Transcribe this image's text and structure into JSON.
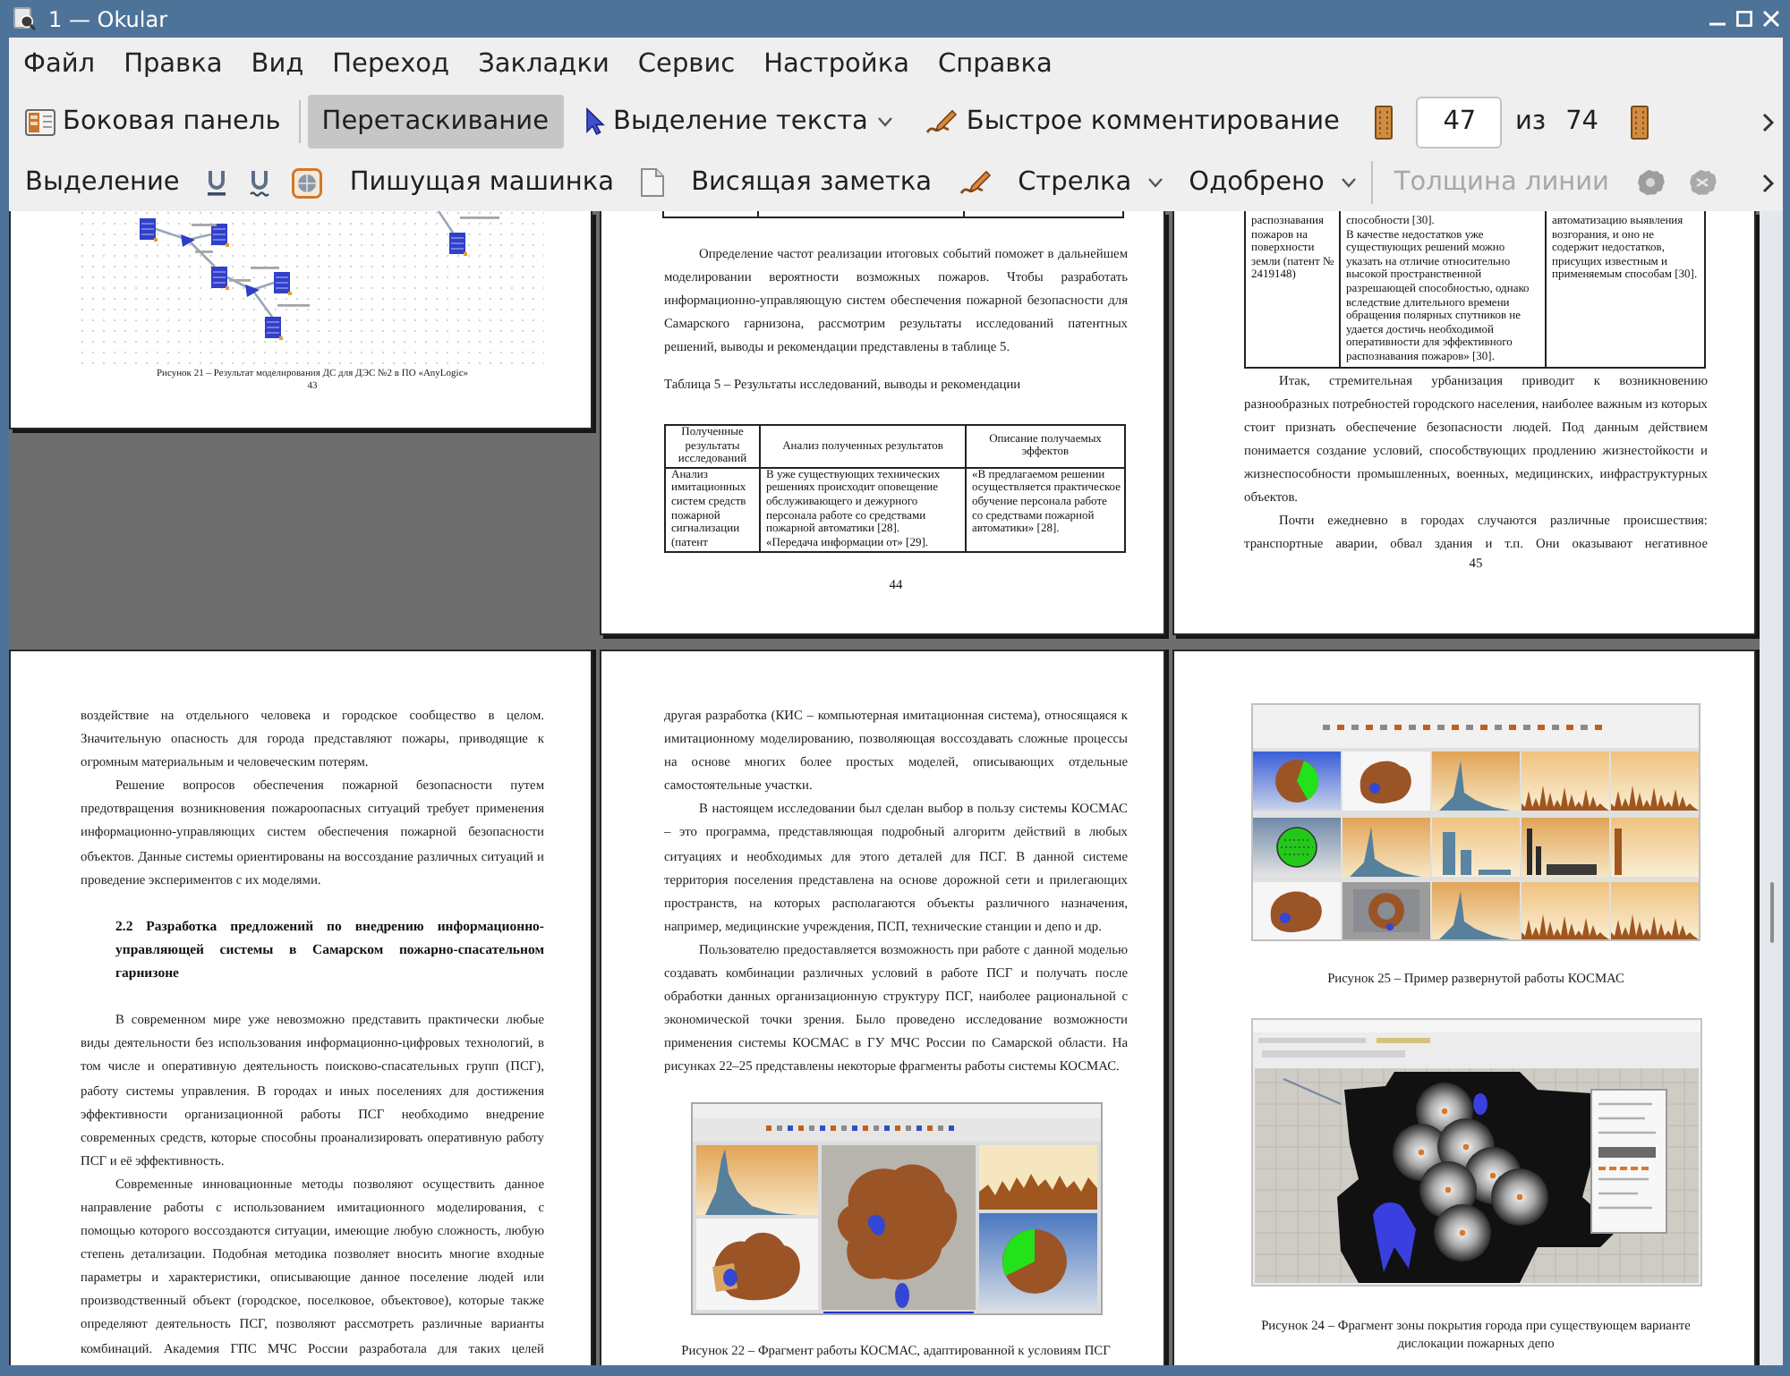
{
  "window": {
    "title": "1 — Okular"
  },
  "menu_bar": [
    "Файл",
    "Правка",
    "Вид",
    "Переход",
    "Закладки",
    "Сервис",
    "Настройка",
    "Справка"
  ],
  "main_toolbar": {
    "sidebar": {
      "label": "Боковая панель"
    },
    "mouse_modes": [
      {
        "label": "Перетаскивание",
        "selected": true,
        "has_menu": false
      },
      {
        "label": "Выделение текста",
        "selected": false,
        "has_menu": true
      }
    ],
    "quick_annotations": {
      "label": "Быстрое комментирование"
    },
    "page_selector": {
      "value": "47",
      "of": "из",
      "total": "74"
    }
  },
  "annotation_toolbar": [
    {
      "kind": "text",
      "label": "Выделение",
      "disabled": false
    },
    {
      "kind": "icon",
      "disabled": false
    },
    {
      "kind": "icon",
      "disabled": false
    },
    {
      "kind": "icon",
      "disabled": false
    },
    {
      "kind": "text",
      "label": "Пишущая машинка",
      "disabled": false
    },
    {
      "kind": "icon",
      "disabled": false
    },
    {
      "kind": "text",
      "label": "Висящая заметка",
      "disabled": false
    },
    {
      "kind": "icon",
      "disabled": false
    },
    {
      "kind": "menu",
      "label": "Стрелка",
      "disabled": false
    },
    {
      "kind": "menu",
      "label": "Одобрено",
      "disabled": false
    },
    {
      "kind": "separator"
    },
    {
      "kind": "text",
      "label": "Толщина линии",
      "disabled": true
    },
    {
      "kind": "icon",
      "disabled": true
    },
    {
      "kind": "icon",
      "disabled": true
    }
  ],
  "pages": [
    {
      "blocks": [
        {
          "kind": "diagram"
        },
        {
          "kind": "caption",
          "text": "Рисунок 21 – Результат моделирования ДС для ДЭС №2 в ПО «AnyLogic»"
        },
        {
          "kind": "page_number",
          "text": "43"
        }
      ]
    },
    {
      "blocks": [
        {
          "kind": "table_end"
        },
        {
          "kind": "paragraph",
          "text": "Определение частот реализации итоговых событий поможет в дальнейшем моделировании вероятности возможных пожаров. Чтобы разработать информационно-управляющую систем обеспечения пожарной безопасности для Самарского гарнизона, рассмотрим результаты исследований патентных решений, выводы и рекомендации представлены в таблице 5."
        },
        {
          "kind": "table_title",
          "text": "Таблица 5 – Результаты исследований, выводы и рекомендации"
        },
        {
          "kind": "table",
          "columns": [
            "Полученные результаты исследований",
            "Анализ полученных результатов",
            "Описание получаемых эффектов"
          ],
          "rows": [
            [
              "Анализ имитационных систем средств пожарной сигнализации (патент",
              "В уже существующих технических решениях происходит оповещение обслуживающего и дежурного персонала работе со средствами пожарной автоматики [28].\n«Передача информации от» [29].",
              "«В предлагаемом решении осуществляется практическое обучение персонала работе со средствами пожарной автоматики» [28]."
            ]
          ]
        },
        {
          "kind": "page_number",
          "text": "44"
        }
      ]
    },
    {
      "blocks": [
        {
          "kind": "table",
          "rows": [
            [
              "распознавания пожаров на поверхности земли (патент № 2419148)",
              "способности [30].\nВ качестве недостатков уже существующих решений можно указать на отличие относительно высокой пространственной разрешающей способностью, однако вследствие длительного времени обращения полярных спутников не удается достичь необходимой оперативности для эффективного распознавания пожаров» [30].",
              "автоматизацию выявления возгорания, и оно не содержит недостатков, присущих известным и применяемым способам [30]."
            ]
          ]
        },
        {
          "kind": "paragraph",
          "text": "Итак, стремительная урбанизация приводит к возникновению разнообразных потребностей городского населения, наиболее важным из которых стоит признать обеспечение безопасности людей. Под данным действием понимается создание условий, способствующих продлению жизнестойкости и жизнеспособности промышленных, военных, медицинских, инфраструктурных объектов."
        },
        {
          "kind": "paragraph",
          "text": "Почти ежедневно в городах случаются различные происшествия: транспортные аварии, обвал здания и т.п. Они оказывают негативное"
        },
        {
          "kind": "page_number",
          "text": "45"
        }
      ]
    },
    {
      "blocks": [
        {
          "kind": "paragraph_continued",
          "text": "воздействие на отдельного человека и городское сообщество в целом. Значительную опасность для города представляют пожары, приводящие к огромным материальным и человеческим потерям."
        },
        {
          "kind": "paragraph",
          "text": "Решение вопросов обеспечения пожарной безопасности путем предотвращения возникновения пожароопасных ситуаций требует применения информационно-управляющих систем обеспечения пожарной безопасности объектов. Данные системы ориентированы на воссоздание различных ситуаций и проведение экспериментов с их моделями."
        },
        {
          "kind": "heading",
          "text": "2.2 Разработка предложений по внедрению информационно-управляющей системы в Самарском пожарно-спасательном гарнизоне"
        },
        {
          "kind": "paragraph",
          "text": "В современном мире уже невозможно представить практически любые виды деятельности без использования информационно-цифровых технологий, в том числе и оперативную деятельность поисково-спасательных групп (ПСГ), работу системы управления. В городах и иных поселениях для достижения эффективности организационной работы ПСГ необходимо внедрение современных средств, которые способны проанализировать оперативную работу ПСГ и её эффективность."
        },
        {
          "kind": "paragraph",
          "text": "Современные инновационные методы позволяют осуществить данное направление работы с использованием имитационного моделирования, с помощью которого воссоздаются ситуации, имеющие любую сложность, любую степень детализации. Подобная методика позволяет вносить многие входные параметры и характеристики, описывающие данное поселение людей или производственный объект (городское, поселковое, объектовое), которые также определяют деятельность ПСГ, позволяют рассмотреть различные варианты комбинаций. Академия ГПС МЧС России разработала для таких целей"
        }
      ]
    },
    {
      "blocks": [
        {
          "kind": "paragraph_continued",
          "text": "другая разработка (КИС – компьютерная имитационная система), относящаяся к имитационному моделированию, позволяющая воссоздавать сложные процессы на основе многих более простых моделей, описывающих отдельные самостоятельные участки."
        },
        {
          "kind": "paragraph",
          "text": "В настоящем исследовании был сделан выбор в пользу системы КОСМАС – это программа, представляющая подробный алгоритм действий в любых ситуациях и необходимых для этого деталей для ПСГ. В данной системе территория поселения представлена на основе дорожной сети и прилегающих пространств, на которых располагаются объекты различного назначения, например, медицинские учреждения, ПСП, технические станции и депо и др."
        },
        {
          "kind": "paragraph",
          "text": "Пользователю предоставляется возможность при работе с данной моделью создавать комбинации различных условий в работе ПСГ и получать после обработки данных организационную структуру ПСГ, наиболее рациональной с экономической точки зрения. Было проведено исследование возможности применения системы КОСМАС в ГУ МЧС России по Самарской области. На рисунках 22–25 представлены некоторые фрагменты работы системы КОСМАС."
        },
        {
          "kind": "app_screenshot"
        },
        {
          "kind": "caption",
          "text": "Рисунок 22 – Фрагмент работы КОСМАС, адаптированной к условиям ПСГ"
        }
      ]
    },
    {
      "blocks": [
        {
          "kind": "panel_grid"
        },
        {
          "kind": "caption",
          "text": "Рисунок 25 – Пример развернутой работы КОСМАС"
        },
        {
          "kind": "coverage_map"
        },
        {
          "kind": "caption",
          "text": "Рисунок 24 – Фрагмент зоны покрытия города при существующем варианте дислокации пожарных депо"
        }
      ]
    }
  ]
}
